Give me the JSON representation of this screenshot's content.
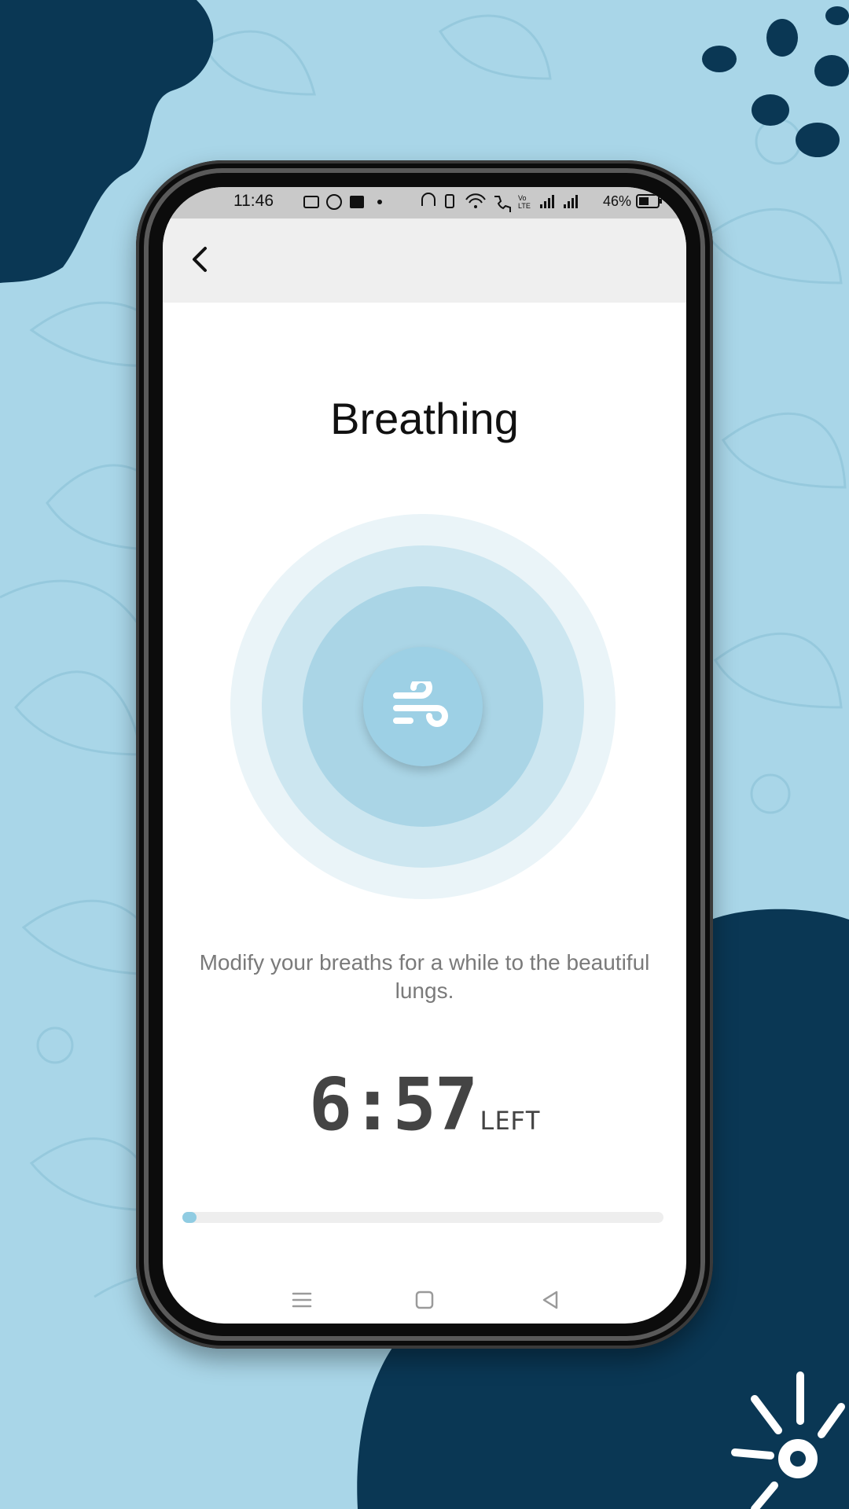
{
  "colors": {
    "background": "#a9d6e8",
    "navy_blob": "#0a3754",
    "accent": "#90cce2",
    "ring_outer": "#eaf4f8",
    "ring_middle": "#cce6f0",
    "ring_inner": "#aad5e6"
  },
  "status_bar": {
    "time": "11:46",
    "battery": "46%"
  },
  "app_bar": {
    "back_icon": "chevron-left-icon"
  },
  "screen": {
    "title": "Breathing",
    "center_icon": "wind-icon",
    "description": "Modify your breaths for a while to the beautiful lungs.",
    "timer": {
      "value": "6:57",
      "unit": "LEFT"
    },
    "progress_fraction": 0.02
  },
  "nav_bar": {
    "icons": [
      "menu-icon",
      "home-square-icon",
      "back-triangle-icon"
    ]
  }
}
